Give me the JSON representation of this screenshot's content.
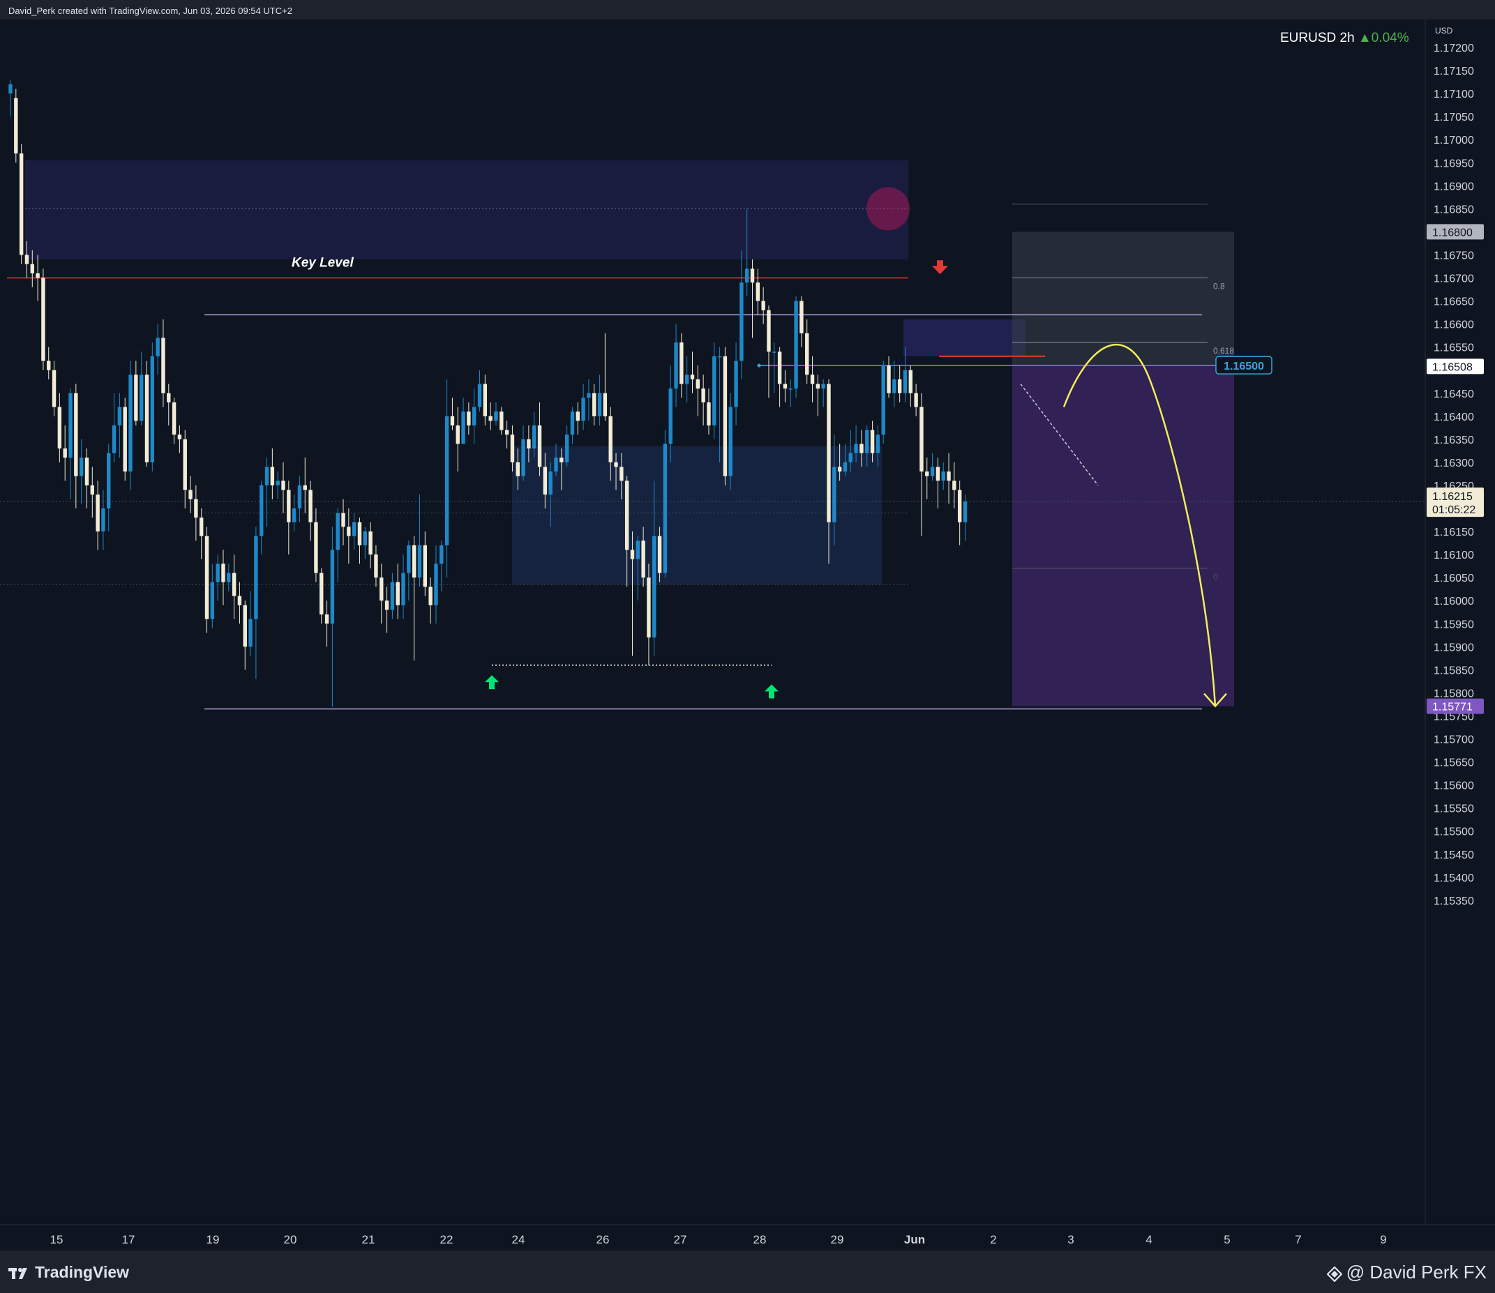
{
  "header": {
    "attribution": "David_Perk created with TradingView.com, Jun 03, 2026 09:54 UTC+2"
  },
  "legend": {
    "symbol": "EURUSD 2h",
    "change": "▲0.04%"
  },
  "currency": "USD",
  "footer": {
    "brand": "TradingView",
    "author": "@ David Perk FX"
  },
  "colors": {
    "background": "#0e1520",
    "bull_candle": "#1e88c9",
    "bear_candle": "#f2ecd6",
    "key_level": "#e53935",
    "range_line": "#b39ddb",
    "projection": "#f3ee5a",
    "target_label": "#7e57c2"
  },
  "chart_data": {
    "type": "candlestick",
    "symbol": "EURUSD",
    "timeframe": "2h",
    "ylim": [
      1.1533,
      1.1723
    ],
    "y_ticks": [
      "1.17200",
      "1.17150",
      "1.17100",
      "1.17050",
      "1.17000",
      "1.16950",
      "1.16900",
      "1.16850",
      "1.16750",
      "1.16700",
      "1.16650",
      "1.16600",
      "1.16550",
      "1.16450",
      "1.16400",
      "1.16350",
      "1.16300",
      "1.16250",
      "1.16150",
      "1.16100",
      "1.16050",
      "1.16000",
      "1.15950",
      "1.15900",
      "1.15850",
      "1.15800",
      "1.15750",
      "1.15700",
      "1.15650",
      "1.15600",
      "1.15550",
      "1.15500",
      "1.15450",
      "1.15400",
      "1.15350"
    ],
    "x_ticks": [
      "15",
      "17",
      "19",
      "20",
      "21",
      "22",
      "24",
      "26",
      "27",
      "28",
      "29",
      "Jun",
      "2",
      "3",
      "4",
      "5",
      "7",
      "9"
    ],
    "candles": [
      [
        1.171,
        1.1712,
        1.1713,
        1.1705
      ],
      [
        1.1709,
        1.1697,
        1.1711,
        1.1695
      ],
      [
        1.1697,
        1.1675,
        1.1699,
        1.1673
      ],
      [
        1.1675,
        1.1673,
        1.1678,
        1.167
      ],
      [
        1.1673,
        1.1671,
        1.1676,
        1.1668
      ],
      [
        1.1671,
        1.167,
        1.1675,
        1.1665
      ],
      [
        1.167,
        1.1652,
        1.1672,
        1.165
      ],
      [
        1.1652,
        1.165,
        1.1655,
        1.1648
      ],
      [
        1.165,
        1.1642,
        1.1652,
        1.164
      ],
      [
        1.1642,
        1.1633,
        1.1645,
        1.163
      ],
      [
        1.1633,
        1.1631,
        1.1638,
        1.1626
      ],
      [
        1.1631,
        1.1645,
        1.1646,
        1.1622
      ],
      [
        1.1645,
        1.1627,
        1.1647,
        1.162
      ],
      [
        1.1627,
        1.1631,
        1.1635,
        1.1621
      ],
      [
        1.1631,
        1.1625,
        1.1633,
        1.162
      ],
      [
        1.1625,
        1.1623,
        1.1629,
        1.1618
      ],
      [
        1.1623,
        1.1615,
        1.1626,
        1.1611
      ],
      [
        1.1615,
        1.162,
        1.1624,
        1.1611
      ],
      [
        1.162,
        1.1632,
        1.1634,
        1.1615
      ],
      [
        1.1632,
        1.1638,
        1.1645,
        1.163
      ],
      [
        1.1638,
        1.1642,
        1.1645,
        1.1631
      ],
      [
        1.1642,
        1.1628,
        1.1644,
        1.1626
      ],
      [
        1.1628,
        1.1649,
        1.1652,
        1.1624
      ],
      [
        1.1649,
        1.1639,
        1.1652,
        1.1638
      ],
      [
        1.1639,
        1.1649,
        1.1654,
        1.1638
      ],
      [
        1.1649,
        1.163,
        1.1652,
        1.1629
      ],
      [
        1.163,
        1.1653,
        1.1656,
        1.1628
      ],
      [
        1.1653,
        1.1657,
        1.166,
        1.1649
      ],
      [
        1.1657,
        1.1645,
        1.1661,
        1.1642
      ],
      [
        1.1645,
        1.1643,
        1.1647,
        1.1638
      ],
      [
        1.1643,
        1.1636,
        1.1644,
        1.1634
      ],
      [
        1.1636,
        1.1635,
        1.1638,
        1.1632
      ],
      [
        1.1635,
        1.1624,
        1.1637,
        1.162
      ],
      [
        1.1624,
        1.1622,
        1.1627,
        1.1619
      ],
      [
        1.1622,
        1.1618,
        1.1625,
        1.1613
      ],
      [
        1.1618,
        1.1614,
        1.162,
        1.1609
      ],
      [
        1.1614,
        1.1596,
        1.1616,
        1.1593
      ],
      [
        1.1596,
        1.1604,
        1.1608,
        1.1594
      ],
      [
        1.1604,
        1.1608,
        1.161,
        1.16
      ],
      [
        1.1608,
        1.1604,
        1.1611,
        1.1599
      ],
      [
        1.1604,
        1.1606,
        1.1608,
        1.1602
      ],
      [
        1.1606,
        1.1601,
        1.161,
        1.1596
      ],
      [
        1.1601,
        1.1599,
        1.1604,
        1.1595
      ],
      [
        1.1599,
        1.159,
        1.16,
        1.1585
      ],
      [
        1.159,
        1.1596,
        1.1602,
        1.1588
      ],
      [
        1.1596,
        1.1614,
        1.1616,
        1.1583
      ],
      [
        1.1614,
        1.1625,
        1.1626,
        1.161
      ],
      [
        1.1625,
        1.1629,
        1.1631,
        1.1616
      ],
      [
        1.1629,
        1.1625,
        1.1633,
        1.1622
      ],
      [
        1.1625,
        1.1626,
        1.1628,
        1.1622
      ],
      [
        1.1626,
        1.1624,
        1.163,
        1.1619
      ],
      [
        1.1624,
        1.1617,
        1.1626,
        1.161
      ],
      [
        1.1617,
        1.162,
        1.1623,
        1.1615
      ],
      [
        1.162,
        1.1625,
        1.1627,
        1.1617
      ],
      [
        1.1625,
        1.1624,
        1.1631,
        1.1619
      ],
      [
        1.1624,
        1.1617,
        1.1626,
        1.1613
      ],
      [
        1.1617,
        1.1606,
        1.162,
        1.1604
      ],
      [
        1.1606,
        1.1597,
        1.1607,
        1.1595
      ],
      [
        1.1597,
        1.1595,
        1.16,
        1.159
      ],
      [
        1.1595,
        1.1611,
        1.1616,
        1.1577
      ],
      [
        1.1611,
        1.1619,
        1.162,
        1.1604
      ],
      [
        1.1619,
        1.1616,
        1.1622,
        1.1612
      ],
      [
        1.1616,
        1.1614,
        1.162,
        1.1608
      ],
      [
        1.1614,
        1.1617,
        1.1619,
        1.1611
      ],
      [
        1.1617,
        1.1612,
        1.1618,
        1.1608
      ],
      [
        1.1612,
        1.1615,
        1.1616,
        1.1609
      ],
      [
        1.1615,
        1.161,
        1.1617,
        1.1607
      ],
      [
        1.161,
        1.1605,
        1.1612,
        1.1603
      ],
      [
        1.1605,
        1.16,
        1.1608,
        1.1595
      ],
      [
        1.16,
        1.1598,
        1.1603,
        1.1593
      ],
      [
        1.1598,
        1.1604,
        1.1606,
        1.1596
      ],
      [
        1.1604,
        1.1599,
        1.1608,
        1.1596
      ],
      [
        1.1599,
        1.1606,
        1.161,
        1.1596
      ],
      [
        1.1606,
        1.1612,
        1.1613,
        1.16
      ],
      [
        1.1612,
        1.1605,
        1.1614,
        1.1587
      ],
      [
        1.1605,
        1.1612,
        1.1623,
        1.1603
      ],
      [
        1.1612,
        1.1603,
        1.1615,
        1.1601
      ],
      [
        1.1603,
        1.1599,
        1.1605,
        1.1595
      ],
      [
        1.1599,
        1.1608,
        1.1612,
        1.1595
      ],
      [
        1.1608,
        1.1612,
        1.1613,
        1.1602
      ],
      [
        1.1612,
        1.164,
        1.1648,
        1.1605
      ],
      [
        1.164,
        1.1638,
        1.1644,
        1.1637
      ],
      [
        1.1638,
        1.1634,
        1.1642,
        1.1628
      ],
      [
        1.1634,
        1.1641,
        1.1644,
        1.1634
      ],
      [
        1.1641,
        1.1638,
        1.1643,
        1.1636
      ],
      [
        1.1638,
        1.1642,
        1.1646,
        1.1634
      ],
      [
        1.1642,
        1.1647,
        1.165,
        1.1641
      ],
      [
        1.1647,
        1.164,
        1.1649,
        1.1638
      ],
      [
        1.164,
        1.1639,
        1.1643,
        1.1637
      ],
      [
        1.1639,
        1.1641,
        1.1643,
        1.1638
      ],
      [
        1.1641,
        1.1637,
        1.1642,
        1.1636
      ],
      [
        1.1637,
        1.1636,
        1.1639,
        1.1633
      ],
      [
        1.1636,
        1.163,
        1.1638,
        1.1628
      ],
      [
        1.163,
        1.1627,
        1.1633,
        1.1624
      ],
      [
        1.1627,
        1.1635,
        1.1638,
        1.1626
      ],
      [
        1.1635,
        1.1633,
        1.1638,
        1.163
      ],
      [
        1.1633,
        1.1638,
        1.1641,
        1.1631
      ],
      [
        1.1638,
        1.1629,
        1.1643,
        1.1627
      ],
      [
        1.1629,
        1.1623,
        1.1632,
        1.162
      ],
      [
        1.1623,
        1.1628,
        1.163,
        1.1616
      ],
      [
        1.1628,
        1.1631,
        1.1634,
        1.1627
      ],
      [
        1.1631,
        1.163,
        1.1633,
        1.1624
      ],
      [
        1.163,
        1.1636,
        1.1638,
        1.1629
      ],
      [
        1.1636,
        1.1641,
        1.1642,
        1.1634
      ],
      [
        1.1641,
        1.1639,
        1.1643,
        1.1636
      ],
      [
        1.1639,
        1.1644,
        1.1647,
        1.1637
      ],
      [
        1.1644,
        1.1645,
        1.1648,
        1.1639
      ],
      [
        1.1645,
        1.164,
        1.1647,
        1.1638
      ],
      [
        1.164,
        1.1645,
        1.1649,
        1.1638
      ],
      [
        1.1645,
        1.164,
        1.1658,
        1.1639
      ],
      [
        1.164,
        1.163,
        1.1642,
        1.1626
      ],
      [
        1.163,
        1.1629,
        1.1632,
        1.1624
      ],
      [
        1.1629,
        1.1626,
        1.1632,
        1.1622
      ],
      [
        1.1626,
        1.1611,
        1.1627,
        1.1603
      ],
      [
        1.1611,
        1.1609,
        1.1615,
        1.1588
      ],
      [
        1.1609,
        1.1613,
        1.1614,
        1.16
      ],
      [
        1.1613,
        1.1605,
        1.1616,
        1.1603
      ],
      [
        1.1605,
        1.1592,
        1.1608,
        1.1586
      ],
      [
        1.1592,
        1.1614,
        1.1626,
        1.1588
      ],
      [
        1.1614,
        1.1606,
        1.1616,
        1.1604
      ],
      [
        1.1606,
        1.1634,
        1.1637,
        1.1605
      ],
      [
        1.1634,
        1.1646,
        1.1651,
        1.163
      ],
      [
        1.1646,
        1.1656,
        1.166,
        1.1642
      ],
      [
        1.1656,
        1.1647,
        1.1658,
        1.1644
      ],
      [
        1.1647,
        1.1649,
        1.1653,
        1.1643
      ],
      [
        1.1649,
        1.1648,
        1.1654,
        1.1645
      ],
      [
        1.1648,
        1.1646,
        1.1651,
        1.164
      ],
      [
        1.1646,
        1.1643,
        1.1649,
        1.1638
      ],
      [
        1.1643,
        1.1638,
        1.1646,
        1.1636
      ],
      [
        1.1638,
        1.1653,
        1.1656,
        1.1635
      ],
      [
        1.1653,
        1.1653,
        1.1655,
        1.163
      ],
      [
        1.1653,
        1.1627,
        1.1655,
        1.1625
      ],
      [
        1.1627,
        1.1642,
        1.1645,
        1.1624
      ],
      [
        1.1642,
        1.1652,
        1.1656,
        1.1638
      ],
      [
        1.1652,
        1.1669,
        1.1676,
        1.1648
      ],
      [
        1.1669,
        1.1672,
        1.1685,
        1.1666
      ],
      [
        1.1672,
        1.1669,
        1.1674,
        1.1657
      ],
      [
        1.1669,
        1.1665,
        1.1672,
        1.1662
      ],
      [
        1.1665,
        1.1663,
        1.1668,
        1.166
      ],
      [
        1.1663,
        1.1654,
        1.1664,
        1.1644
      ],
      [
        1.1654,
        1.1654,
        1.1656,
        1.1645
      ],
      [
        1.1654,
        1.1647,
        1.1655,
        1.1642
      ],
      [
        1.1647,
        1.1646,
        1.165,
        1.1643
      ],
      [
        1.1646,
        1.1646,
        1.1648,
        1.1642
      ],
      [
        1.1646,
        1.1665,
        1.1666,
        1.1644
      ],
      [
        1.1665,
        1.1658,
        1.1666,
        1.1655
      ],
      [
        1.1658,
        1.1649,
        1.1661,
        1.1647
      ],
      [
        1.1649,
        1.1647,
        1.1653,
        1.1643
      ],
      [
        1.1647,
        1.1646,
        1.1649,
        1.164
      ],
      [
        1.1646,
        1.1647,
        1.1648,
        1.1642
      ],
      [
        1.1647,
        1.1617,
        1.1648,
        1.1608
      ],
      [
        1.1617,
        1.1629,
        1.1636,
        1.1612
      ],
      [
        1.1629,
        1.1628,
        1.1634,
        1.1626
      ],
      [
        1.1628,
        1.163,
        1.1634,
        1.1627
      ],
      [
        1.163,
        1.1632,
        1.1637,
        1.1628
      ],
      [
        1.1632,
        1.1634,
        1.1638,
        1.163
      ],
      [
        1.1634,
        1.1632,
        1.1637,
        1.1629
      ],
      [
        1.1632,
        1.1637,
        1.1638,
        1.1629
      ],
      [
        1.1637,
        1.1632,
        1.1639,
        1.163
      ],
      [
        1.1632,
        1.1636,
        1.1638,
        1.1629
      ],
      [
        1.1636,
        1.1651,
        1.1652,
        1.1634
      ],
      [
        1.1651,
        1.1645,
        1.1653,
        1.1644
      ],
      [
        1.1645,
        1.1648,
        1.1652,
        1.1642
      ],
      [
        1.1648,
        1.1645,
        1.1651,
        1.1643
      ],
      [
        1.1645,
        1.165,
        1.1655,
        1.1643
      ],
      [
        1.165,
        1.1645,
        1.1651,
        1.1642
      ],
      [
        1.1645,
        1.1642,
        1.1647,
        1.164
      ],
      [
        1.1642,
        1.1628,
        1.1645,
        1.1614
      ],
      [
        1.1628,
        1.1627,
        1.1631,
        1.1622
      ],
      [
        1.1627,
        1.1629,
        1.1632,
        1.1626
      ],
      [
        1.1629,
        1.1626,
        1.1631,
        1.162
      ],
      [
        1.1626,
        1.1628,
        1.163,
        1.1624
      ],
      [
        1.1628,
        1.1626,
        1.1632,
        1.1621
      ],
      [
        1.1626,
        1.1624,
        1.163,
        1.162
      ],
      [
        1.1624,
        1.1617,
        1.1626,
        1.1612
      ],
      [
        1.1617,
        1.16215,
        1.1623,
        1.1613
      ]
    ],
    "annotations": {
      "key_level": {
        "label": "Key Level",
        "price": 1.167
      },
      "supply_zone": {
        "top": 1.16955,
        "bottom": 1.1674
      },
      "range_high": 1.1662,
      "range_low": 1.15765,
      "demand_zone": {
        "top": 1.16335,
        "bottom": 1.16035
      },
      "marked_level": {
        "label": "1.16500",
        "price": 1.1651
      },
      "current_price": {
        "price": "1.16215",
        "countdown": "01:05:22"
      },
      "last_label": "1.16508",
      "upper_grey_label": "1.16800",
      "target": {
        "label": "1.15771",
        "price": 1.15771
      },
      "fib_labels": [
        "0.8",
        "0.618",
        "0"
      ],
      "projection": "curved path up to about 1.16530 then down to 1.15771"
    }
  }
}
